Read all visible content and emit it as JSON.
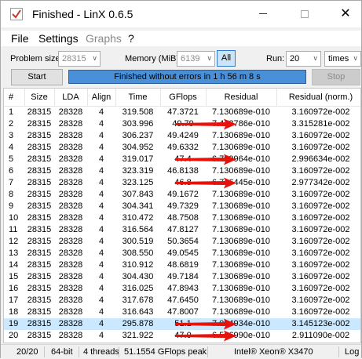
{
  "window": {
    "title": "Finished - LinX 0.6.5",
    "minimize": "",
    "maximize": "",
    "close": "✕"
  },
  "menu": {
    "file": "File",
    "settings": "Settings",
    "graphs": "Graphs",
    "help": "?"
  },
  "controls": {
    "problem_size_label": "Problem size:",
    "problem_size_value": "28315",
    "memory_label": "Memory (MiB):",
    "memory_value": "6139",
    "all_label": "All",
    "run_label": "Run:",
    "run_value": "20",
    "run_unit": "times"
  },
  "actions": {
    "start": "Start",
    "status": "Finished without errors in 1 h 56 m 8 s",
    "stop": "Stop"
  },
  "table": {
    "headers": [
      "#",
      "Size",
      "LDA",
      "Align",
      "Time",
      "GFlops",
      "Residual",
      "Residual (norm.)"
    ],
    "rows": [
      [
        "1",
        "28315",
        "28328",
        "4",
        "319.508",
        "47.3721",
        "7.130689e-010",
        "3.160972e-002"
      ],
      [
        "2",
        "28315",
        "28328",
        "4",
        "303.996",
        "49.79",
        "7.478786e-010",
        "3.315281e-002"
      ],
      [
        "3",
        "28315",
        "28328",
        "4",
        "306.237",
        "49.4249",
        "7.130689e-010",
        "3.160972e-002"
      ],
      [
        "4",
        "28315",
        "28328",
        "4",
        "304.952",
        "49.6332",
        "7.130689e-010",
        "3.160972e-002"
      ],
      [
        "5",
        "28315",
        "28328",
        "4",
        "319.017",
        "47.4",
        "6.759964e-010",
        "2.996634e-002"
      ],
      [
        "6",
        "28315",
        "28328",
        "4",
        "323.319",
        "46.8138",
        "7.130689e-010",
        "3.160972e-002"
      ],
      [
        "7",
        "28315",
        "28328",
        "4",
        "323.125",
        "46.8",
        "6.716445e-010",
        "2.977342e-002"
      ],
      [
        "8",
        "28315",
        "28328",
        "4",
        "307.843",
        "49.1672",
        "7.130689e-010",
        "3.160972e-002"
      ],
      [
        "9",
        "28315",
        "28328",
        "4",
        "304.341",
        "49.7329",
        "7.130689e-010",
        "3.160972e-002"
      ],
      [
        "10",
        "28315",
        "28328",
        "4",
        "310.472",
        "48.7508",
        "7.130689e-010",
        "3.160972e-002"
      ],
      [
        "11",
        "28315",
        "28328",
        "4",
        "316.564",
        "47.8127",
        "7.130689e-010",
        "3.160972e-002"
      ],
      [
        "12",
        "28315",
        "28328",
        "4",
        "300.519",
        "50.3654",
        "7.130689e-010",
        "3.160972e-002"
      ],
      [
        "13",
        "28315",
        "28328",
        "4",
        "308.550",
        "49.0545",
        "7.130689e-010",
        "3.160972e-002"
      ],
      [
        "14",
        "28315",
        "28328",
        "4",
        "310.912",
        "48.6819",
        "7.130689e-010",
        "3.160972e-002"
      ],
      [
        "15",
        "28315",
        "28328",
        "4",
        "304.430",
        "49.7184",
        "7.130689e-010",
        "3.160972e-002"
      ],
      [
        "16",
        "28315",
        "28328",
        "4",
        "316.025",
        "47.8943",
        "7.130689e-010",
        "3.160972e-002"
      ],
      [
        "17",
        "28315",
        "28328",
        "4",
        "317.678",
        "47.6450",
        "7.130689e-010",
        "3.160972e-002"
      ],
      [
        "18",
        "28315",
        "28328",
        "4",
        "316.643",
        "47.8007",
        "7.130689e-010",
        "3.160972e-002"
      ],
      [
        "19",
        "28315",
        "28328",
        "4",
        "295.878",
        "51.1",
        "7.094934e-010",
        "3.145123e-002"
      ],
      [
        "20",
        "28315",
        "28328",
        "4",
        "321.922",
        "47.0",
        "6.566990e-010",
        "2.911090e-002"
      ]
    ],
    "selected_row": 19,
    "annotation_arrow_rows": [
      2,
      5,
      7,
      19,
      20
    ],
    "annotation_color": "#e8120c"
  },
  "footer": {
    "progress": "20/20",
    "bits": "64-bit",
    "threads": "4 threads",
    "gflops": "51.1554 GFlops peak",
    "cpu": "Intel® Xeon® X3470",
    "log": "Log :"
  },
  "colors": {
    "status_fill": "#4a90d9",
    "selection": "#cce8ff",
    "accent_button": "#cce4f7"
  }
}
